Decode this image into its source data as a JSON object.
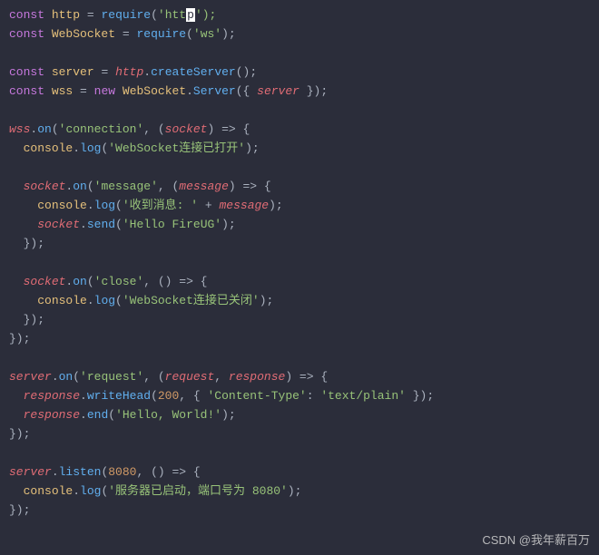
{
  "code": {
    "import_http": {
      "kw": "const",
      "var": "http",
      "eq": "=",
      "fn": "require",
      "str": "'htt",
      "cursor": "p",
      "close": "');"
    },
    "import_ws": {
      "kw": "const",
      "var": "WebSocket",
      "eq": "=",
      "fn": "require",
      "str": "'ws'",
      "close": ");"
    },
    "server_decl": {
      "kw": "const",
      "var": "server",
      "eq": "=",
      "obj": "http",
      "dot": ".",
      "fn": "createServer",
      "close": "();"
    },
    "wss_decl": {
      "kw": "const",
      "var": "wss",
      "eq": "=",
      "new": "new",
      "cls": "WebSocket",
      "dot": ".",
      "sub": "Server",
      "open": "({ ",
      "arg": "server",
      "close": " });"
    },
    "wss_on": {
      "obj": "wss",
      "dot": ".",
      "fn": "on",
      "open": "(",
      "str": "'connection'",
      "sep": ", (",
      "arg": "socket",
      "close": ") => {"
    },
    "log_open": {
      "obj": "console",
      "dot": ".",
      "fn": "log",
      "open": "(",
      "str": "'WebSocket连接已打开'",
      "close": ");"
    },
    "socket_msg": {
      "obj": "socket",
      "dot": ".",
      "fn": "on",
      "open": "(",
      "str": "'message'",
      "sep": ", (",
      "arg": "message",
      "close": ") => {"
    },
    "log_msg": {
      "obj": "console",
      "dot": ".",
      "fn": "log",
      "open": "(",
      "str": "'收到消息: '",
      "plus": " + ",
      "var": "message",
      "close": ");"
    },
    "socket_send": {
      "obj": "socket",
      "dot": ".",
      "fn": "send",
      "open": "(",
      "str": "'Hello FireUG'",
      "close": ");"
    },
    "end1": "});",
    "socket_close": {
      "obj": "socket",
      "dot": ".",
      "fn": "on",
      "open": "(",
      "str": "'close'",
      "sep": ", () => {",
      "close": ""
    },
    "log_close": {
      "obj": "console",
      "dot": ".",
      "fn": "log",
      "open": "(",
      "str": "'WebSocket连接已关闭'",
      "close": ");"
    },
    "end2": "});",
    "end3": "});",
    "server_req": {
      "obj": "server",
      "dot": ".",
      "fn": "on",
      "open": "(",
      "str": "'request'",
      "sep": ", (",
      "arg1": "request",
      "comma": ", ",
      "arg2": "response",
      "close": ") => {"
    },
    "write_head": {
      "obj": "response",
      "dot": ".",
      "fn": "writeHead",
      "open": "(",
      "num": "200",
      "sep": ", { ",
      "key": "'Content-Type'",
      "colon": ": ",
      "val": "'text/plain'",
      "close": " });"
    },
    "resp_end": {
      "obj": "response",
      "dot": ".",
      "fn": "end",
      "open": "(",
      "str": "'Hello, World!'",
      "close": ");"
    },
    "end4": "});",
    "listen": {
      "obj": "server",
      "dot": ".",
      "fn": "listen",
      "open": "(",
      "num": "8080",
      "sep": ", () => {",
      "close": ""
    },
    "log_listen": {
      "obj": "console",
      "dot": ".",
      "fn": "log",
      "open": "(",
      "str": "'服务器已启动，端口号为 8080'",
      "close": ");"
    },
    "end5": "});"
  },
  "watermark": "CSDN @我年薪百万"
}
